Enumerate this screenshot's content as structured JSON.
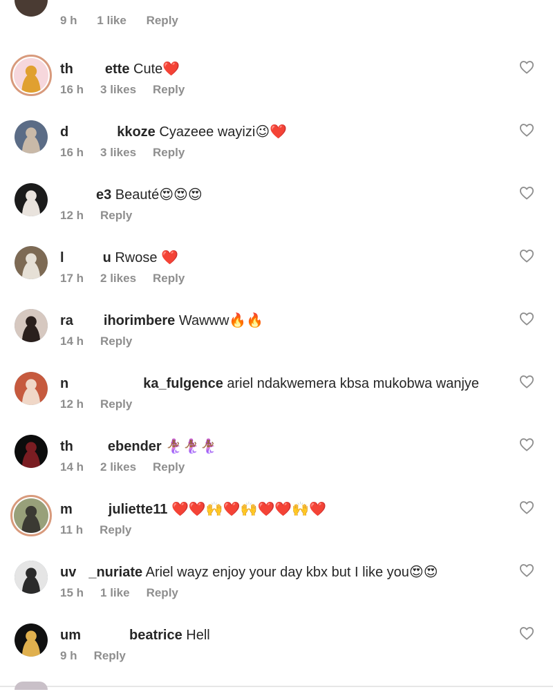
{
  "top_comment": {
    "time": "9 h",
    "likes": "1 like",
    "reply": "Reply"
  },
  "comments": [
    {
      "user": "th",
      "user_end": "ette",
      "text": "Cute❤️",
      "time": "16 h",
      "likes": "3 likes",
      "reply": "Reply"
    },
    {
      "user": "d",
      "user_end": "kkoze",
      "text": "Cyazeee wayizi😉❤️",
      "time": "16 h",
      "likes": "3 likes",
      "reply": "Reply"
    },
    {
      "user": "",
      "user_end": "e3",
      "text": "Beauté😍😍😍",
      "time": "12 h",
      "likes": "",
      "reply": "Reply"
    },
    {
      "user": "l",
      "user_end": "u",
      "text": "Rwose ❤️",
      "time": "17 h",
      "likes": "2 likes",
      "reply": "Reply"
    },
    {
      "user": "ra",
      "user_end": "ihorimbere",
      "text": "Wawww🔥🔥",
      "time": "14 h",
      "likes": "",
      "reply": "Reply"
    },
    {
      "user": "n",
      "user_end": "ka_fulgence",
      "text": "ariel ndakwemera kbsa mukobwa wanjye",
      "time": "12 h",
      "likes": "",
      "reply": "Reply"
    },
    {
      "user": "th",
      "user_end": "ebender",
      "text": "🧜🏾‍♀️🧜🏾‍♀️🧜🏾‍♀️",
      "time": "14 h",
      "likes": "2 likes",
      "reply": "Reply"
    },
    {
      "user": "m",
      "user_end": "juliette11",
      "text": "❤️❤️🙌❤️🙌❤️❤️🙌❤️",
      "time": "11 h",
      "likes": "",
      "reply": "Reply"
    },
    {
      "user": "uv",
      "user_end": "_nuriate",
      "text": "Ariel wayz enjoy your day kbx but  I like you😍😍",
      "time": "15 h",
      "likes": "1 like",
      "reply": "Reply"
    },
    {
      "user": "um",
      "user_end": "beatrice",
      "text": "Hell",
      "time": "9 h",
      "likes": "",
      "reply": "Reply"
    }
  ],
  "colors": {
    "text": "#262626",
    "meta": "#8e8e8e",
    "ring": "#d89a7c",
    "icon": "#8e8e8e"
  },
  "icons": {
    "like": "heart-outline-icon"
  }
}
